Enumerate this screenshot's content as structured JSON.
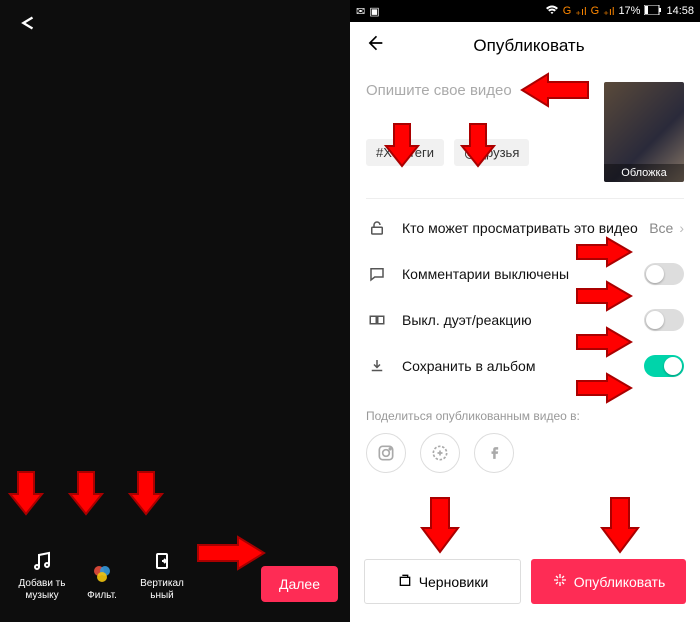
{
  "status": {
    "battery": "17%",
    "time": "14:58",
    "carrier": "G"
  },
  "left": {
    "tools": [
      {
        "label": "Добави\nть\nмузыку",
        "icon": "music-icon"
      },
      {
        "label": "Фильт.",
        "icon": "filter-icon"
      },
      {
        "label": "Вертикал\nьный",
        "icon": "rotate-icon"
      }
    ],
    "next": "Далее"
  },
  "right": {
    "title": "Опубликовать",
    "description_placeholder": "Опишите свое видео",
    "hashtag_chip": "#Хэштеги",
    "friends_chip": "@Друзья",
    "cover_label": "Обложка",
    "settings": {
      "privacy": {
        "label": "Кто может просматривать это видео",
        "value": "Все"
      },
      "comments": {
        "label": "Комментарии выключены"
      },
      "duet": {
        "label": "Выкл. дуэт/реакцию"
      },
      "save": {
        "label": "Сохранить в альбом"
      }
    },
    "share_label": "Поделиться опубликованным видео в:",
    "drafts": "Черновики",
    "publish": "Опубликовать"
  }
}
